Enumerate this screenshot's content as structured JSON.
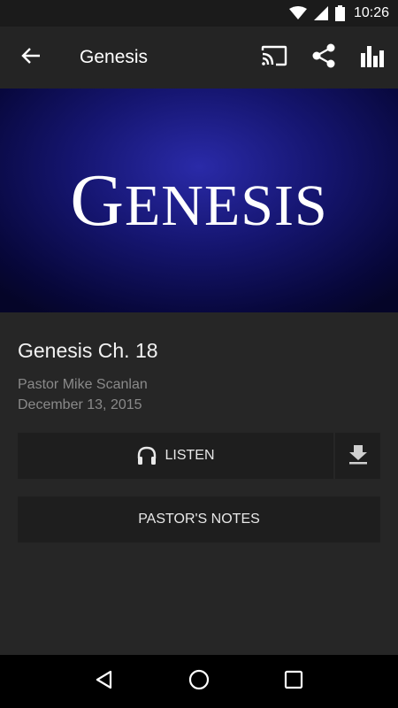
{
  "status_bar": {
    "time": "10:26"
  },
  "app_bar": {
    "title": "Genesis"
  },
  "hero": {
    "text_cap": "G",
    "text_rest": "ENESIS"
  },
  "sermon": {
    "title": "Genesis Ch. 18",
    "speaker": "Pastor Mike Scanlan",
    "date": "December 13, 2015"
  },
  "actions": {
    "listen_label": "LISTEN",
    "notes_label": "PASTOR'S NOTES"
  },
  "icons": {
    "wifi": "wifi-icon",
    "signal": "signal-icon",
    "battery": "battery-icon",
    "back": "arrow-back-icon",
    "cast": "cast-icon",
    "share": "share-icon",
    "stats": "bar-chart-icon",
    "headphones": "headphones-icon",
    "download": "download-icon",
    "nav_back": "triangle-back-icon",
    "nav_home": "circle-home-icon",
    "nav_recents": "square-recents-icon"
  },
  "colors": {
    "background": "#262626",
    "app_bar": "#242424",
    "button": "#1e1e1e",
    "secondary_text": "#8a8a8a",
    "hero_blue": "#15156f"
  }
}
